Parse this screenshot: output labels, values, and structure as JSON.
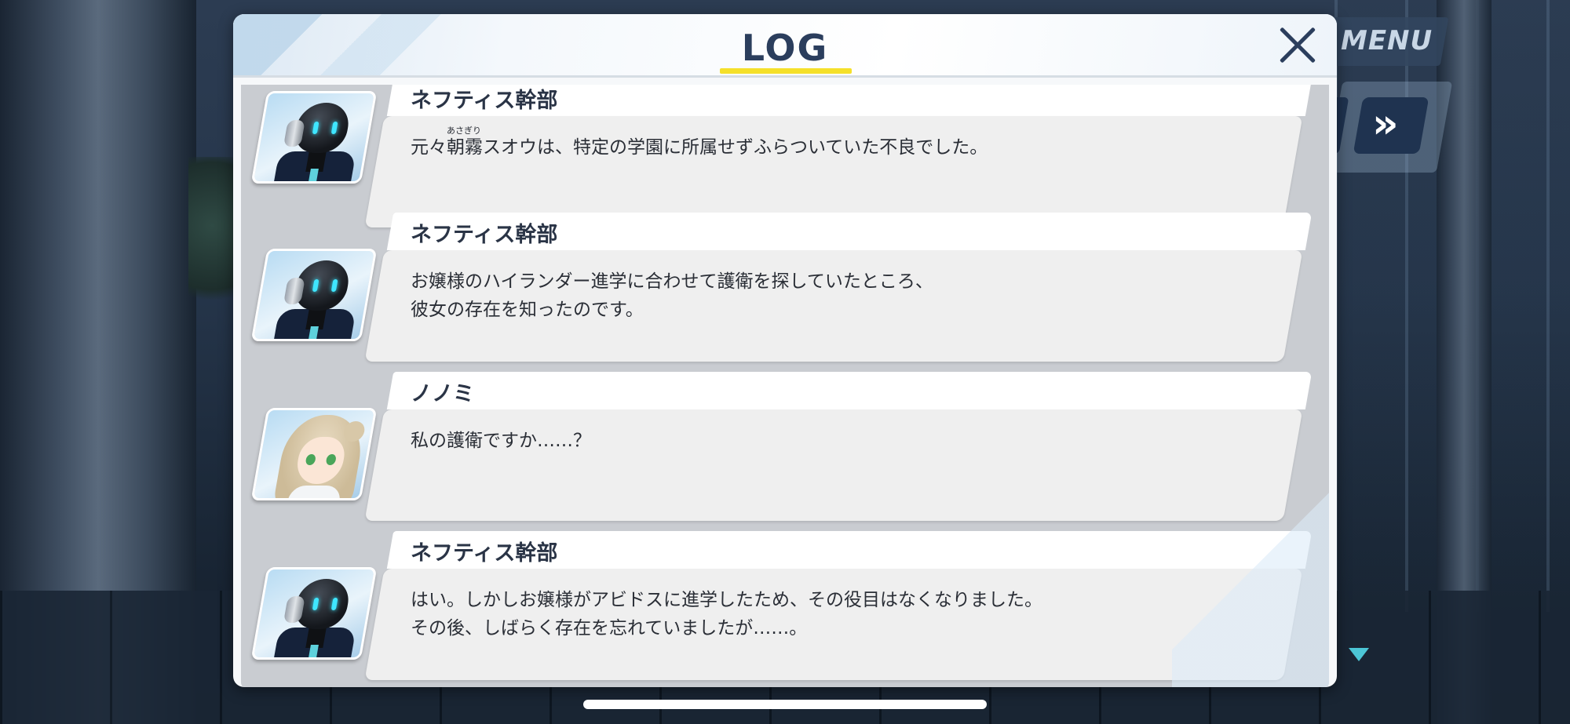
{
  "hud": {
    "menu_label": "MENU",
    "skip_icon": "»"
  },
  "log": {
    "title": "LOG",
    "entries": [
      {
        "speaker": "ネフティス幹部",
        "portrait": "robot-executive",
        "ruby": "あさぎり",
        "message": "元々朝霧スオウは、特定の学園に所属せずふらついていた不良でした。"
      },
      {
        "speaker": "ネフティス幹部",
        "portrait": "robot-executive",
        "message": "お嬢様のハイランダー進学に合わせて護衛を探していたところ、\n彼女の存在を知ったのです。"
      },
      {
        "speaker": "ノノミ",
        "portrait": "nonomi",
        "message": "私の護衛ですか……？"
      },
      {
        "speaker": "ネフティス幹部",
        "portrait": "robot-executive",
        "message": "はい。しかしお嬢様がアビドスに進学したため、その役目はなくなりました。\nその後、しばらく存在を忘れていましたが……。"
      }
    ]
  },
  "colors": {
    "title": "#2b3e5d",
    "underline": "#f5e02a",
    "robot_eye": "#3fe6ff"
  }
}
